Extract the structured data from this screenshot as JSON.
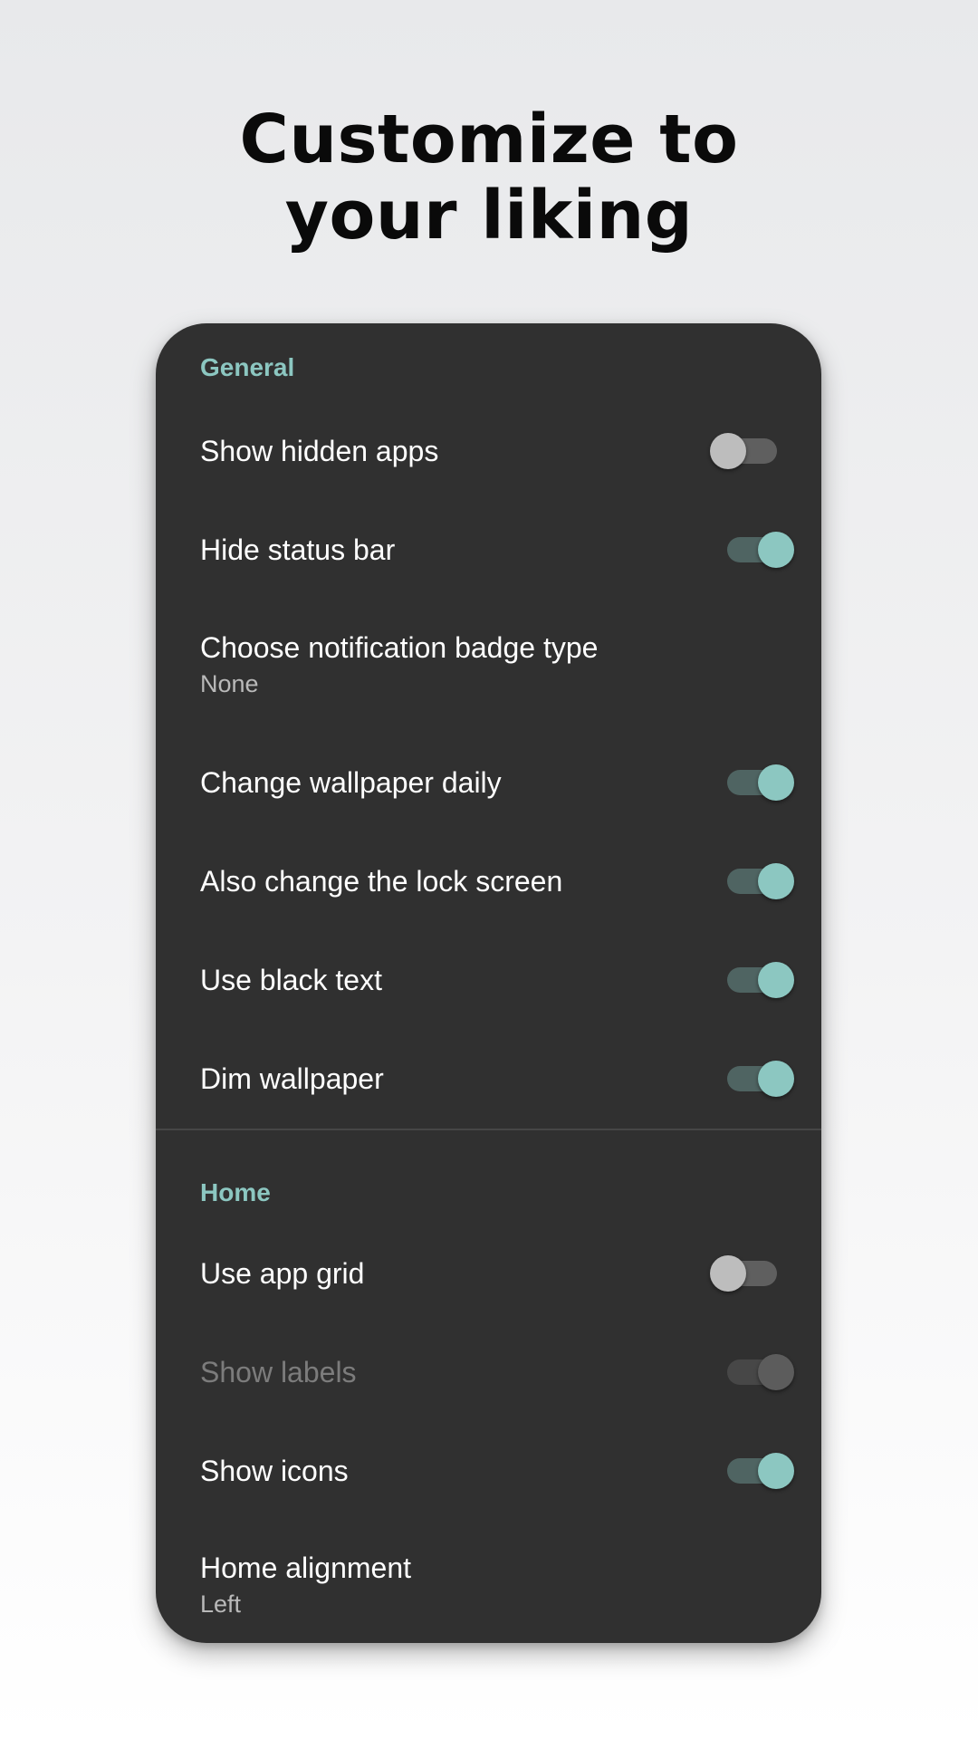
{
  "headline": {
    "line1": "Customize to",
    "line2": "your liking"
  },
  "colors": {
    "accent": "#8cc7c1",
    "card_background": "#303030",
    "toggle_track_on": "#4f6462",
    "toggle_thumb_off": "#bdbdbd"
  },
  "sections": {
    "general": {
      "header": "General",
      "items": [
        {
          "title": "Show hidden apps",
          "toggle": "off"
        },
        {
          "title": "Hide status bar",
          "toggle": "on"
        },
        {
          "title": "Choose notification badge type",
          "subtitle": "None"
        },
        {
          "title": "Change wallpaper daily",
          "toggle": "on"
        },
        {
          "title": "Also change the lock screen",
          "toggle": "on"
        },
        {
          "title": "Use black text",
          "toggle": "on"
        },
        {
          "title": "Dim wallpaper",
          "toggle": "on"
        }
      ]
    },
    "home": {
      "header": "Home",
      "items": [
        {
          "title": "Use app grid",
          "toggle": "off"
        },
        {
          "title": "Show labels",
          "toggle": "on",
          "disabled": true
        },
        {
          "title": "Show icons",
          "toggle": "on"
        },
        {
          "title": "Home alignment",
          "subtitle": "Left"
        }
      ]
    }
  }
}
